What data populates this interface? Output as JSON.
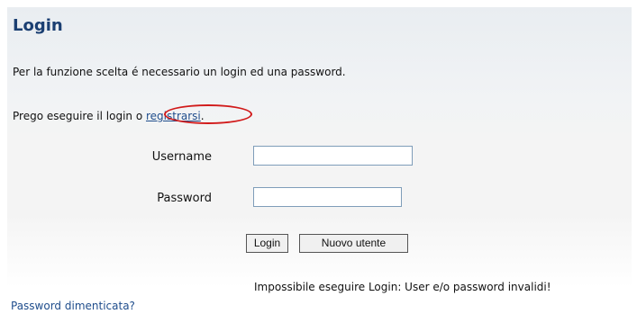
{
  "login": {
    "title": "Login",
    "intro": "Per la funzione scelta é necessario un login ed una password.",
    "prompt_prefix": "Prego eseguire il login o ",
    "register_link": "registrarsi",
    "prompt_suffix": ".",
    "username_label": "Username",
    "username_value": "",
    "password_label": "Password",
    "password_value": "",
    "login_button": "Login",
    "new_user_button": "Nuovo utente",
    "error_message": "Impossibile eseguire Login: User e/o password invalidi!",
    "forgot_password_link": "Password dimenticata?"
  },
  "colors": {
    "title": "#1b3f72",
    "link": "#1f4d8c",
    "highlight": "#d11a1a",
    "input_border": "#7f9db9"
  }
}
